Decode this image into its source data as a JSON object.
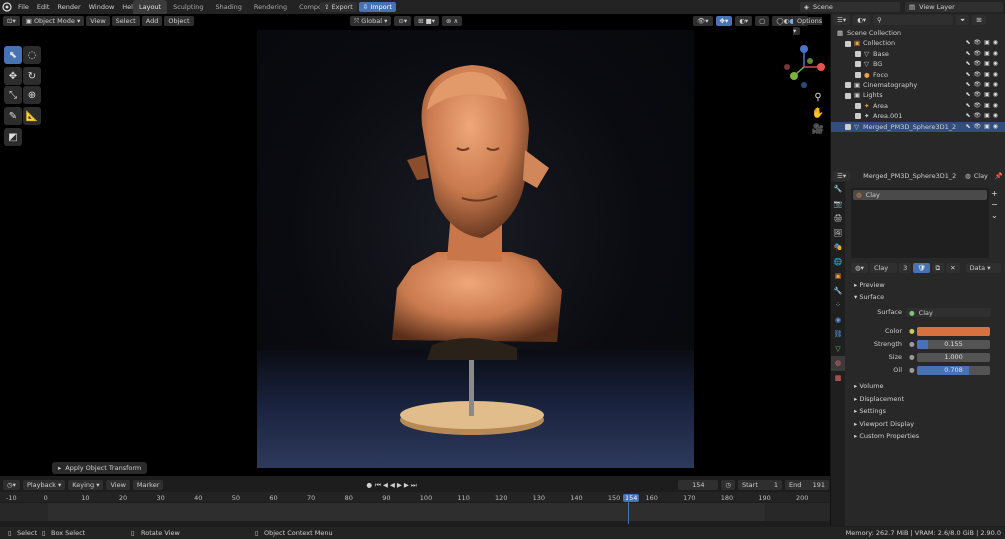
{
  "topbar": {
    "menu": [
      "File",
      "Edit",
      "Render",
      "Window",
      "Help"
    ],
    "workspaces": [
      "Layout",
      "Sculpting",
      "Shading",
      "Rendering",
      "Compositing"
    ],
    "active_workspace": "Layout",
    "add_tab": "+",
    "export": "Export",
    "import": "Import",
    "scene": "Scene",
    "view_layer": "View Layer"
  },
  "viewport": {
    "mode": "Object Mode",
    "menu": [
      "View",
      "Select",
      "Add",
      "Object"
    ],
    "orientation": "Global",
    "options": "Options",
    "operator_panel": "Apply Object Transform"
  },
  "outliner": {
    "root": "Scene Collection",
    "rows": [
      {
        "name": "Collection",
        "indent": 1
      },
      {
        "name": "Base",
        "indent": 2
      },
      {
        "name": "BG",
        "indent": 2
      },
      {
        "name": "Foco",
        "indent": 2
      },
      {
        "name": "Cinematography",
        "indent": 1
      },
      {
        "name": "Lights",
        "indent": 1
      },
      {
        "name": "Area",
        "indent": 2
      },
      {
        "name": "Area.001",
        "indent": 2
      },
      {
        "name": "Merged_PM3D_Sphere3D1_2",
        "indent": 1,
        "selected": true
      }
    ]
  },
  "properties": {
    "object_name": "Merged_PM3D_Sphere3D1_2",
    "material_slot": "Clay",
    "material": "Clay",
    "users": "3",
    "link": "Data",
    "sections": [
      "Preview",
      "Surface"
    ],
    "surface_label": "Surface",
    "surface_value": "Clay",
    "color_label": "Color",
    "color_value": "#d9713f",
    "fields": [
      {
        "label": "Strength",
        "value": "0.155",
        "fill": 0.155
      },
      {
        "label": "Size",
        "value": "1.000",
        "fill": 0
      },
      {
        "label": "Oil",
        "value": "0.708",
        "fill": 0.708
      }
    ],
    "collapsed": [
      "Volume",
      "Displacement",
      "Settings",
      "Viewport Display",
      "Custom Properties"
    ]
  },
  "timeline": {
    "menu": [
      "Playback",
      "Keying",
      "View",
      "Marker"
    ],
    "current_frame": "154",
    "start_label": "Start",
    "start": "1",
    "end_label": "End",
    "end": "191",
    "ticks": [
      "-10",
      "0",
      "10",
      "20",
      "30",
      "40",
      "50",
      "60",
      "70",
      "80",
      "90",
      "100",
      "110",
      "120",
      "130",
      "140",
      "150",
      "154",
      "160",
      "170",
      "180",
      "190",
      "200"
    ]
  },
  "status": {
    "items": [
      "Select",
      "Box Select",
      "Rotate View",
      "Object Context Menu"
    ],
    "memory": "Memory: 262.7 MiB | VRAM: 2.6/8.0 GiB | 2.90.0"
  },
  "colors": {
    "accent": "#4772b3",
    "selection": "#334d80",
    "material": "#d9713f"
  }
}
